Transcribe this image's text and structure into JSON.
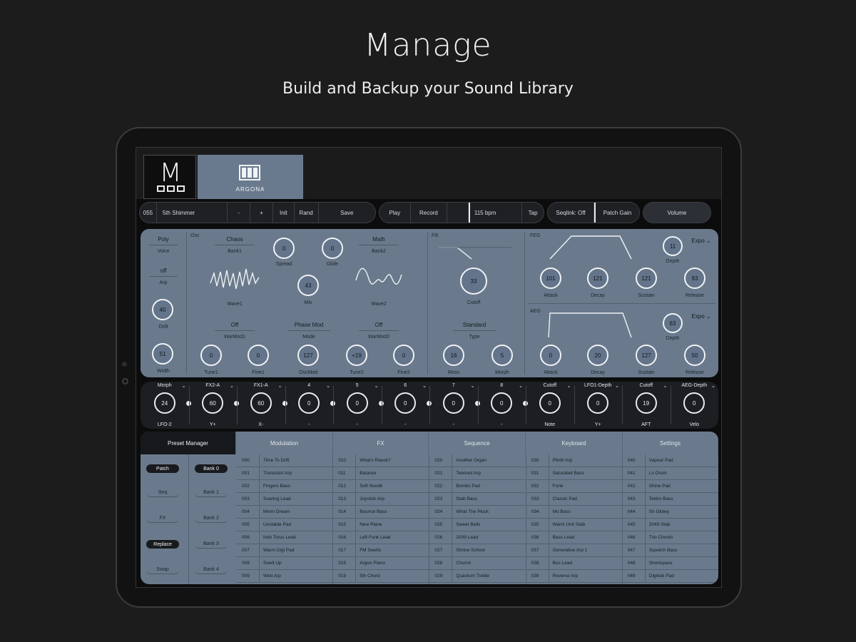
{
  "marketing": {
    "title": "Manage",
    "subtitle": "Build and Backup your Sound Library"
  },
  "app": {
    "logo_letter": "M",
    "instrument_label": "ARGONA",
    "transport": {
      "patch_number": "055",
      "patch_name": "5th Shimmer",
      "prev": "-",
      "next": "+",
      "init": "Init",
      "rand": "Rand",
      "save": "Save",
      "play": "Play",
      "record": "Record",
      "bpm": "115 bpm",
      "tap": "Tap",
      "seqlink": "Seqlink: Off",
      "patch_gain": "Patch Gain",
      "volume": "Volume"
    },
    "voice": {
      "poly": "Poly",
      "voice_label": "Voice",
      "arp_value": "off",
      "arp_label": "Arp",
      "drift_value": "40",
      "drift_label": "Drift",
      "width_value": "51",
      "width_label": "Width"
    },
    "osc": {
      "header": "Osc",
      "osc1_name": "Chaos",
      "osc1_bank": "Bank1",
      "spread_value": "0",
      "spread_label": "Spread",
      "glide_value": "0",
      "glide_label": "Glide",
      "osc2_name": "Math",
      "osc2_bank": "Bank2",
      "wave1_label": "Wave1",
      "mix_value": "43",
      "mix_label": "Mix",
      "wave2_label": "Wave2",
      "warmod1_value": "Off",
      "warmod1_label": "WarMod1",
      "mode_value": "Phase Mod",
      "mode_label": "Mode",
      "warmod2_value": "Off",
      "warmod2_label": "WarMod2",
      "tune1_value": "0",
      "tune1_label": "Tune1",
      "fine1_value": "0",
      "fine1_label": "Fine1",
      "oscmod_value": "127",
      "oscmod_label": "OscMod",
      "tune2_value": "+19",
      "tune2_label": "Tune2",
      "fine2_value": "0",
      "fine2_label": "Fine2"
    },
    "filter": {
      "header": "Filt",
      "cutoff_value": "33",
      "cutoff_label": "Cutoff",
      "type_value": "Standard",
      "type_label": "Type",
      "reso_value": "16",
      "reso_label": "Reso",
      "morph_value": "5",
      "morph_label": "Morph"
    },
    "feg": {
      "header": "FEG",
      "curve": "Expo",
      "depth_value": "11",
      "depth_label": "Depth",
      "attack_value": "101",
      "decay_value": "121",
      "sustain_value": "121",
      "release_value": "93",
      "attack_label": "Attack",
      "decay_label": "Decay",
      "sustain_label": "Sustain",
      "release_label": "Release"
    },
    "aeg": {
      "header": "AEG",
      "curve": "Expo",
      "depth_value": "63",
      "depth_label": "Depth",
      "attack_value": "0",
      "decay_value": "20",
      "sustain_value": "127",
      "release_value": "50",
      "attack_label": "Attack",
      "decay_label": "Decay",
      "sustain_label": "Sustain",
      "release_label": "Release"
    },
    "mod_slots": [
      {
        "title": "Morph",
        "value": "24",
        "source": "LFO-2"
      },
      {
        "title": "FX2-A",
        "value": "60",
        "source": "Y+"
      },
      {
        "title": "FX1-A",
        "value": "60",
        "source": "X-"
      },
      {
        "title": "4",
        "value": "0",
        "source": "-"
      },
      {
        "title": "5",
        "value": "0",
        "source": "-"
      },
      {
        "title": "6",
        "value": "0",
        "source": "-"
      },
      {
        "title": "7",
        "value": "0",
        "source": "-"
      },
      {
        "title": "8",
        "value": "0",
        "source": "-"
      },
      {
        "title": "Cutoff",
        "value": "0",
        "source": "Note"
      },
      {
        "title": "LFO1-Depth",
        "value": "0",
        "source": "Y+"
      },
      {
        "title": "Cutoff",
        "value": "19",
        "source": "AFT"
      },
      {
        "title": "AEG-Depth",
        "value": "0",
        "source": "Velo"
      }
    ],
    "bottom_tabs": [
      "Preset Manager",
      "Modulation",
      "FX",
      "Sequence",
      "Keyboard",
      "Settings"
    ],
    "preset_left": {
      "types": [
        "Patch",
        "Seq",
        "FX",
        "Replace",
        "Swap"
      ],
      "banks": [
        "Bank 0",
        "Bank 1",
        "Bank 2",
        "Bank 3",
        "Bank 4"
      ]
    },
    "presets": [
      [
        [
          "000",
          "Time To Drift"
        ],
        [
          "001",
          "Transistor Arp"
        ],
        [
          "002",
          "Fingers Bass"
        ],
        [
          "003",
          "Soaring Lead"
        ],
        [
          "004",
          "Mmm Dream"
        ],
        [
          "005",
          "Unstable Pad"
        ],
        [
          "006",
          "Nob Torus Lead"
        ],
        [
          "007",
          "Warm Digi Pad"
        ],
        [
          "008",
          "Swell Up"
        ],
        [
          "009",
          "Wett Arp"
        ]
      ],
      [
        [
          "010",
          "What's Reeck?"
        ],
        [
          "011",
          "Balance"
        ],
        [
          "012",
          "Soft Noodk"
        ],
        [
          "013",
          "Joystick Arp"
        ],
        [
          "014",
          "Bounce Bass"
        ],
        [
          "015",
          "New Plane"
        ],
        [
          "016",
          "Left Funk Lead"
        ],
        [
          "017",
          "FM Swells"
        ],
        [
          "018",
          "Argon Piano"
        ],
        [
          "019",
          "5th Chord"
        ]
      ],
      [
        [
          "020",
          "Another Organ"
        ],
        [
          "021",
          "Teenout Arp"
        ],
        [
          "022",
          "Bombs Pad"
        ],
        [
          "023",
          "Stab Bass"
        ],
        [
          "024",
          "What The Pluck"
        ],
        [
          "025",
          "Sweet Bells"
        ],
        [
          "026",
          "2009 Lead"
        ],
        [
          "027",
          "Shrine School"
        ],
        [
          "028",
          "Church"
        ],
        [
          "029",
          "Quantum Treble"
        ]
      ],
      [
        [
          "030",
          "Plinth Arp"
        ],
        [
          "031",
          "Saturated Bass"
        ],
        [
          "032",
          "Forle"
        ],
        [
          "033",
          "Classic Pad"
        ],
        [
          "034",
          "Mo Bass"
        ],
        [
          "035",
          "Warm Unit Stab"
        ],
        [
          "036",
          "Bass Lead"
        ],
        [
          "037",
          "Generative Arp 1"
        ],
        [
          "038",
          "Bus Lead"
        ],
        [
          "039",
          "Reverse Arp"
        ]
      ],
      [
        [
          "040",
          "Vapour Pad"
        ],
        [
          "041",
          "Lo Drum"
        ],
        [
          "042",
          "Shine Pad"
        ],
        [
          "043",
          "Tektro Bass"
        ],
        [
          "044",
          "Sh Glidey"
        ],
        [
          "045",
          "2049 Stab"
        ],
        [
          "046",
          "Trio Chords"
        ],
        [
          "047",
          "Squelch Bass"
        ],
        [
          "048",
          "Shortspace"
        ],
        [
          "049",
          "Digitide Pad"
        ]
      ]
    ]
  }
}
